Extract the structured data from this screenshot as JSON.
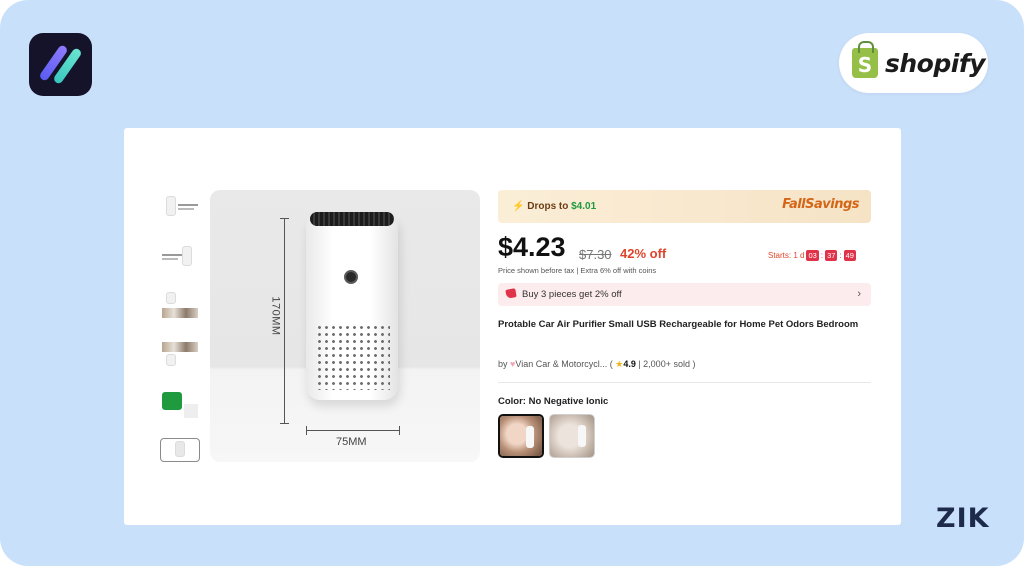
{
  "brand": {
    "shopify_text": "shopify",
    "bag_letter": "S",
    "zik_text": "ZIK"
  },
  "product_images": {
    "thumbnails": [
      "thumb-1",
      "thumb-2",
      "thumb-3",
      "thumb-4",
      "thumb-5",
      "thumb-6"
    ],
    "height_label": "170MM",
    "width_label": "75MM"
  },
  "promo": {
    "drops_text": "Drops to ",
    "drops_price": "$4.01",
    "fall_savings": "FallSavings"
  },
  "pricing": {
    "price": "$4.23",
    "original_price": "$7.30",
    "discount": "42% off",
    "note": "Price shown before tax  |  Extra 6% off with coins"
  },
  "timer": {
    "label": "Starts:",
    "days": "1 d",
    "hours": "03",
    "minutes": "37",
    "seconds": "49"
  },
  "buy_offer": {
    "text": "Buy 3 pieces get 2% off"
  },
  "product": {
    "title": "Protable Car Air Purifier Small USB Rechargeable for Home Pet Odors Bedroom",
    "seller_prefix": "by ",
    "seller_name": "Vian Car & Motorcycl... ",
    "rating": "4.9",
    "sold": "2,000+ sold"
  },
  "color": {
    "label": "Color: No Negative Ionic"
  },
  "colors": {
    "background": "#c9e0fb",
    "accent_red": "#e0452b",
    "accent_green": "#1f9a3e",
    "shopify_green": "#95bf47"
  }
}
